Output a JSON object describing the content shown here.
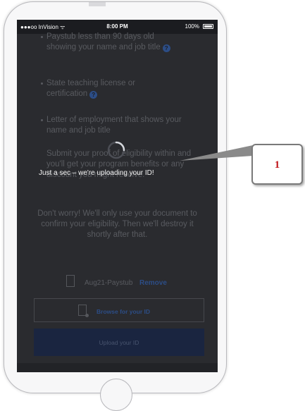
{
  "statusbar": {
    "carrier": "●●●oo InVision ᯤ",
    "time": "8:00 PM",
    "battery": "100%"
  },
  "bullets": [
    {
      "text": "Paystub less than 90 days old showing your name and job title"
    },
    {
      "text": "State teaching license or certification"
    },
    {
      "text": "Letter of employment that shows your name and job title"
    }
  ],
  "submit_text": "Submit your proof of eligibility within and you'll get your program benefits or any discount you might receive.",
  "loading_text": "Just a sec – we're uploading your ID!",
  "privacy_text": "Don't worry! We'll only use your document to confirm your eligibility. Then we'll destroy it shortly after that.",
  "file": {
    "name": "Aug21-Paystub",
    "remove_label": "Remove"
  },
  "browse_label": "Browse for your ID",
  "upload_label": "Upload your ID",
  "callout": {
    "number": "1"
  },
  "help_icon_glyph": "?",
  "colors": {
    "overlay": "#2a2b2f",
    "link": "#2c4d86",
    "upload_button": "#1a2540",
    "callout_number": "#c0151a"
  }
}
